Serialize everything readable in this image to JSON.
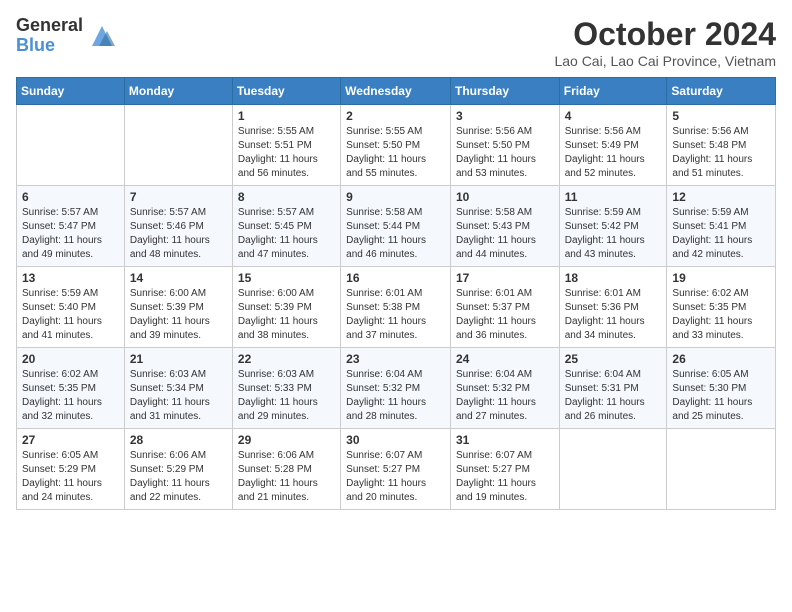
{
  "header": {
    "logo_line1": "General",
    "logo_line2": "Blue",
    "month_title": "October 2024",
    "location": "Lao Cai, Lao Cai Province, Vietnam"
  },
  "weekdays": [
    "Sunday",
    "Monday",
    "Tuesday",
    "Wednesday",
    "Thursday",
    "Friday",
    "Saturday"
  ],
  "weeks": [
    [
      {
        "day": "",
        "content": ""
      },
      {
        "day": "",
        "content": ""
      },
      {
        "day": "1",
        "content": "Sunrise: 5:55 AM\nSunset: 5:51 PM\nDaylight: 11 hours and 56 minutes."
      },
      {
        "day": "2",
        "content": "Sunrise: 5:55 AM\nSunset: 5:50 PM\nDaylight: 11 hours and 55 minutes."
      },
      {
        "day": "3",
        "content": "Sunrise: 5:56 AM\nSunset: 5:50 PM\nDaylight: 11 hours and 53 minutes."
      },
      {
        "day": "4",
        "content": "Sunrise: 5:56 AM\nSunset: 5:49 PM\nDaylight: 11 hours and 52 minutes."
      },
      {
        "day": "5",
        "content": "Sunrise: 5:56 AM\nSunset: 5:48 PM\nDaylight: 11 hours and 51 minutes."
      }
    ],
    [
      {
        "day": "6",
        "content": "Sunrise: 5:57 AM\nSunset: 5:47 PM\nDaylight: 11 hours and 49 minutes."
      },
      {
        "day": "7",
        "content": "Sunrise: 5:57 AM\nSunset: 5:46 PM\nDaylight: 11 hours and 48 minutes."
      },
      {
        "day": "8",
        "content": "Sunrise: 5:57 AM\nSunset: 5:45 PM\nDaylight: 11 hours and 47 minutes."
      },
      {
        "day": "9",
        "content": "Sunrise: 5:58 AM\nSunset: 5:44 PM\nDaylight: 11 hours and 46 minutes."
      },
      {
        "day": "10",
        "content": "Sunrise: 5:58 AM\nSunset: 5:43 PM\nDaylight: 11 hours and 44 minutes."
      },
      {
        "day": "11",
        "content": "Sunrise: 5:59 AM\nSunset: 5:42 PM\nDaylight: 11 hours and 43 minutes."
      },
      {
        "day": "12",
        "content": "Sunrise: 5:59 AM\nSunset: 5:41 PM\nDaylight: 11 hours and 42 minutes."
      }
    ],
    [
      {
        "day": "13",
        "content": "Sunrise: 5:59 AM\nSunset: 5:40 PM\nDaylight: 11 hours and 41 minutes."
      },
      {
        "day": "14",
        "content": "Sunrise: 6:00 AM\nSunset: 5:39 PM\nDaylight: 11 hours and 39 minutes."
      },
      {
        "day": "15",
        "content": "Sunrise: 6:00 AM\nSunset: 5:39 PM\nDaylight: 11 hours and 38 minutes."
      },
      {
        "day": "16",
        "content": "Sunrise: 6:01 AM\nSunset: 5:38 PM\nDaylight: 11 hours and 37 minutes."
      },
      {
        "day": "17",
        "content": "Sunrise: 6:01 AM\nSunset: 5:37 PM\nDaylight: 11 hours and 36 minutes."
      },
      {
        "day": "18",
        "content": "Sunrise: 6:01 AM\nSunset: 5:36 PM\nDaylight: 11 hours and 34 minutes."
      },
      {
        "day": "19",
        "content": "Sunrise: 6:02 AM\nSunset: 5:35 PM\nDaylight: 11 hours and 33 minutes."
      }
    ],
    [
      {
        "day": "20",
        "content": "Sunrise: 6:02 AM\nSunset: 5:35 PM\nDaylight: 11 hours and 32 minutes."
      },
      {
        "day": "21",
        "content": "Sunrise: 6:03 AM\nSunset: 5:34 PM\nDaylight: 11 hours and 31 minutes."
      },
      {
        "day": "22",
        "content": "Sunrise: 6:03 AM\nSunset: 5:33 PM\nDaylight: 11 hours and 29 minutes."
      },
      {
        "day": "23",
        "content": "Sunrise: 6:04 AM\nSunset: 5:32 PM\nDaylight: 11 hours and 28 minutes."
      },
      {
        "day": "24",
        "content": "Sunrise: 6:04 AM\nSunset: 5:32 PM\nDaylight: 11 hours and 27 minutes."
      },
      {
        "day": "25",
        "content": "Sunrise: 6:04 AM\nSunset: 5:31 PM\nDaylight: 11 hours and 26 minutes."
      },
      {
        "day": "26",
        "content": "Sunrise: 6:05 AM\nSunset: 5:30 PM\nDaylight: 11 hours and 25 minutes."
      }
    ],
    [
      {
        "day": "27",
        "content": "Sunrise: 6:05 AM\nSunset: 5:29 PM\nDaylight: 11 hours and 24 minutes."
      },
      {
        "day": "28",
        "content": "Sunrise: 6:06 AM\nSunset: 5:29 PM\nDaylight: 11 hours and 22 minutes."
      },
      {
        "day": "29",
        "content": "Sunrise: 6:06 AM\nSunset: 5:28 PM\nDaylight: 11 hours and 21 minutes."
      },
      {
        "day": "30",
        "content": "Sunrise: 6:07 AM\nSunset: 5:27 PM\nDaylight: 11 hours and 20 minutes."
      },
      {
        "day": "31",
        "content": "Sunrise: 6:07 AM\nSunset: 5:27 PM\nDaylight: 11 hours and 19 minutes."
      },
      {
        "day": "",
        "content": ""
      },
      {
        "day": "",
        "content": ""
      }
    ]
  ]
}
